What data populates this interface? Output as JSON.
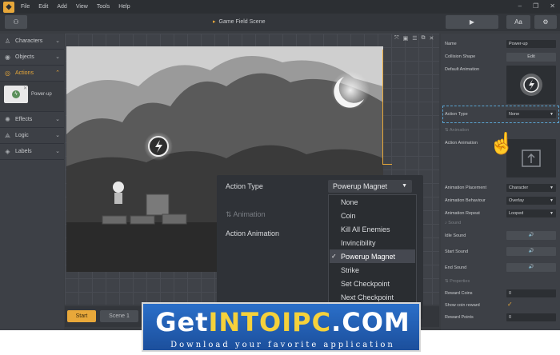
{
  "menu": [
    "File",
    "Edit",
    "Add",
    "View",
    "Tools",
    "Help"
  ],
  "toolbar": {
    "scene_title": "Game Field Scene",
    "play_icon": "play-icon",
    "font_button": "Aa",
    "settings_icon": "gear-icon"
  },
  "left_panel": {
    "items": [
      {
        "label": "Characters",
        "icon": "characters-icon"
      },
      {
        "label": "Objects",
        "icon": "objects-icon"
      },
      {
        "label": "Actions",
        "icon": "actions-icon"
      },
      {
        "label": "Effects",
        "icon": "effects-icon"
      },
      {
        "label": "Logic",
        "icon": "logic-icon"
      },
      {
        "label": "Labels",
        "icon": "labels-icon"
      }
    ],
    "action_item": "Power-up"
  },
  "bottom": {
    "start": "Start",
    "scene1": "Scene 1"
  },
  "properties": {
    "name_label": "Name",
    "name_value": "Power-up",
    "collision_label": "Collision Shape",
    "collision_button": "Edit",
    "default_anim_label": "Default Animation",
    "action_type_label": "Action Type",
    "action_type_value": "None",
    "animation_section": "Animation",
    "action_anim_label": "Action Animation",
    "placement_label": "Animation Placement",
    "placement_value": "Character",
    "behaviour_label": "Animation Behaviour",
    "behaviour_value": "Overlay",
    "repeat_label": "Animation Repeat",
    "repeat_value": "Looped",
    "sound_section": "Sound",
    "idle_sound": "Idle Sound",
    "start_sound": "Start Sound",
    "end_sound": "End Sound",
    "properties_section": "Properties",
    "reward_coins_label": "Reward Coins",
    "reward_coins_value": "0",
    "show_coin_label": "Show coin reward",
    "reward_points_label": "Reward Points",
    "reward_points_value": "0"
  },
  "popup": {
    "action_type_label": "Action Type",
    "selected": "Powerup Magnet",
    "animation_section": "Animation",
    "action_animation_label": "Action Animation",
    "options": [
      "None",
      "Coin",
      "Kill All Enemies",
      "Invincibility",
      "Powerup Magnet",
      "Strike",
      "Set Checkpoint",
      "Next Checkpoint"
    ]
  },
  "watermark": {
    "main_a": "Get",
    "main_b": "INTO",
    "main_c": "IPC",
    "main_d": ".COM",
    "sub": "Download your favorite application"
  }
}
